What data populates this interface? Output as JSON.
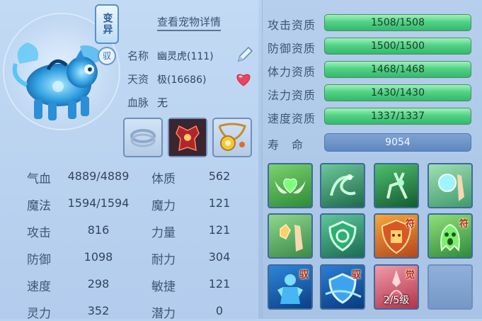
{
  "pet": {
    "mutant_label": "变异",
    "yu_label": "驭",
    "detail_link": "查看宠物详情",
    "name_key": "名称",
    "name_value": "幽灵虎(111)",
    "talent_key": "天资",
    "talent_value": "极(16686)",
    "bloodline_key": "血脉",
    "bloodline_value": "无"
  },
  "equipment": [
    {
      "icon": "empty-ring-slot-icon"
    },
    {
      "icon": "red-armor-icon"
    },
    {
      "icon": "golden-amulet-icon"
    }
  ],
  "stats": [
    {
      "key": "气血",
      "value": "4889/4889",
      "key2": "体质",
      "value2": "562"
    },
    {
      "key": "魔法",
      "value": "1594/1594",
      "key2": "魔力",
      "value2": "121"
    },
    {
      "key": "攻击",
      "value": "816",
      "key2": "力量",
      "value2": "121"
    },
    {
      "key": "防御",
      "value": "1098",
      "key2": "耐力",
      "value2": "304"
    },
    {
      "key": "速度",
      "value": "298",
      "key2": "敏捷",
      "value2": "121"
    },
    {
      "key": "灵力",
      "value": "352",
      "key2": "潜力",
      "value2": "0"
    }
  ],
  "aptitudes": [
    {
      "label": "攻击资质",
      "text": "1508/1508",
      "fraction": 1.0
    },
    {
      "label": "防御资质",
      "text": "1500/1500",
      "fraction": 1.0
    },
    {
      "label": "体力资质",
      "text": "1468/1468",
      "fraction": 1.0
    },
    {
      "label": "法力资质",
      "text": "1430/1430",
      "fraction": 1.0
    },
    {
      "label": "速度资质",
      "text": "1337/1337",
      "fraction": 1.0
    }
  ],
  "life": {
    "label": "寿　命",
    "value": "9054"
  },
  "skills": [
    {
      "icon": "winged-heart-skill-icon",
      "tag": ""
    },
    {
      "icon": "green-spirit-skill-icon",
      "tag": ""
    },
    {
      "icon": "green-deer-skill-icon",
      "tag": ""
    },
    {
      "icon": "palm-orb-skill-icon",
      "tag": ""
    },
    {
      "icon": "palm-crystal-skill-icon",
      "tag": ""
    },
    {
      "icon": "green-shield-skill-icon",
      "tag": ""
    },
    {
      "icon": "totem-shield-skill-icon",
      "tag": "符"
    },
    {
      "icon": "green-ghost-skill-icon",
      "tag": "符"
    },
    {
      "icon": "blue-guardian-skill-icon",
      "tag": "驭"
    },
    {
      "icon": "blue-shield-skill-icon",
      "tag": "驭"
    },
    {
      "icon": "red-awaken-skill-icon",
      "tag": "觉",
      "level": "2/5级"
    },
    {
      "icon": "empty-skill-slot-icon",
      "tag": ""
    }
  ]
}
